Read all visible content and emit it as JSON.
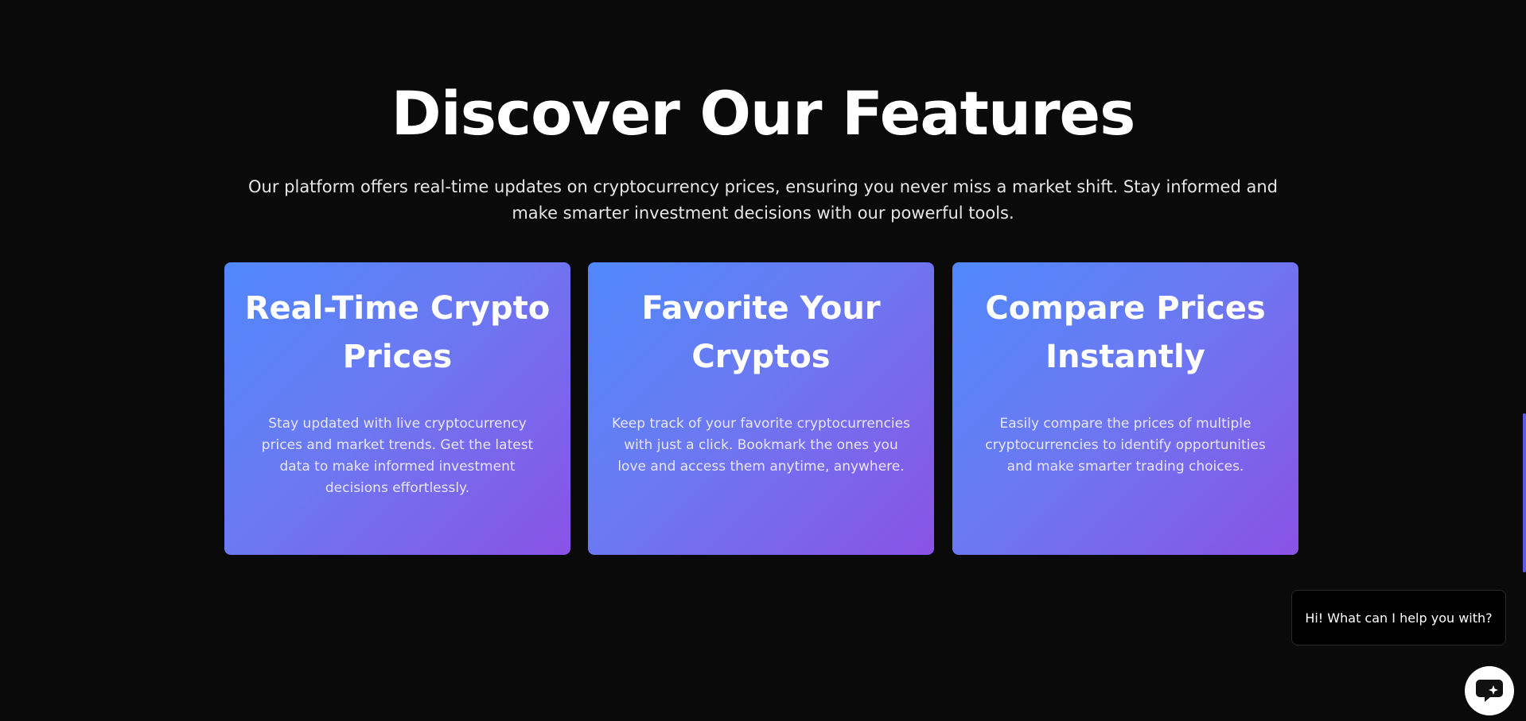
{
  "features": {
    "title": "Discover Our Features",
    "subtitle": "Our platform offers real-time updates on cryptocurrency prices, ensuring you never miss a market shift. Stay informed and make smarter investment decisions with our powerful tools.",
    "cards": [
      {
        "title": "Real-Time Crypto Prices",
        "text": "Stay updated with live cryptocurrency prices and market trends. Get the latest data to make informed investment decisions effortlessly."
      },
      {
        "title": "Favorite Your Cryptos",
        "text": "Keep track of your favorite cryptocurrencies with just a click. Bookmark the ones you love and access them anytime, anywhere."
      },
      {
        "title": "Compare Prices Instantly",
        "text": "Easily compare the prices of multiple cryptocurrencies to identify opportunities and make smarter trading choices."
      }
    ]
  },
  "chat": {
    "greeting": "Hi! What can I help you with?",
    "launcher_icon": "chat-bubble-sparkle-icon"
  },
  "colors": {
    "background": "#0a0a0a",
    "card_gradient_start": "#5088fb",
    "card_gradient_end": "#8a52e6",
    "scroll_thumb": "#5a5fe0"
  }
}
